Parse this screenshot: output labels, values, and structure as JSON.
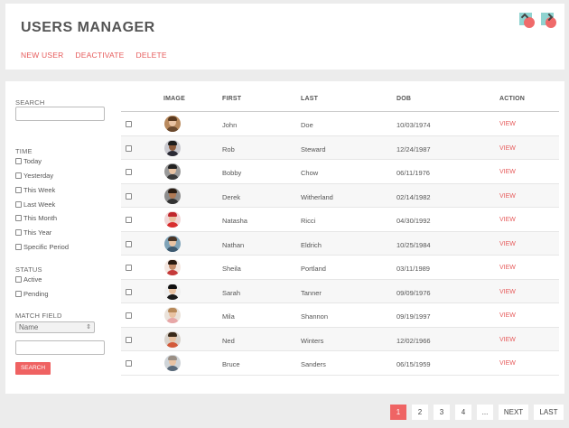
{
  "header": {
    "title": "USERS MANAGER",
    "icons": [
      "import-icon",
      "export-icon"
    ],
    "actions": [
      "NEW USER",
      "DEACTIVATE",
      "DELETE"
    ]
  },
  "sidebar": {
    "search_label": "SEARCH",
    "search_value": "",
    "time_label": "TIME",
    "time_options": [
      "Today",
      "Yesterday",
      "This Week",
      "Last Week",
      "This Month",
      "This Year",
      "Specific Period"
    ],
    "status_label": "STATUS",
    "status_options": [
      "Active",
      "Pending"
    ],
    "match_label": "MATCH FIELD",
    "match_select": "Name",
    "match_value": "",
    "search_button": "SEARCH"
  },
  "table": {
    "columns": [
      "IMAGE",
      "FIRST",
      "LAST",
      "DOB",
      "ACTION"
    ],
    "rows": [
      {
        "first": "John",
        "last": "Doe",
        "dob": "10/03/1974",
        "action": "VIEW",
        "avatar": "avatar-man-brown"
      },
      {
        "first": "Rob",
        "last": "Steward",
        "dob": "12/24/1987",
        "action": "VIEW",
        "avatar": "avatar-man-dark"
      },
      {
        "first": "Bobby",
        "last": "Chow",
        "dob": "06/11/1976",
        "action": "VIEW",
        "avatar": "avatar-man-gray"
      },
      {
        "first": "Derek",
        "last": "Witherland",
        "dob": "02/14/1982",
        "action": "VIEW",
        "avatar": "avatar-man-beard"
      },
      {
        "first": "Natasha",
        "last": "Ricci",
        "dob": "04/30/1992",
        "action": "VIEW",
        "avatar": "avatar-woman-red"
      },
      {
        "first": "Nathan",
        "last": "Eldrich",
        "dob": "10/25/1984",
        "action": "VIEW",
        "avatar": "avatar-man-blue"
      },
      {
        "first": "Sheila",
        "last": "Portland",
        "dob": "03/11/1989",
        "action": "VIEW",
        "avatar": "avatar-woman-dark"
      },
      {
        "first": "Sarah",
        "last": "Tanner",
        "dob": "09/09/1976",
        "action": "VIEW",
        "avatar": "avatar-woman-black"
      },
      {
        "first": "Mila",
        "last": "Shannon",
        "dob": "09/19/1997",
        "action": "VIEW",
        "avatar": "avatar-woman-light"
      },
      {
        "first": "Ned",
        "last": "Winters",
        "dob": "12/02/1966",
        "action": "VIEW",
        "avatar": "avatar-man-light"
      },
      {
        "first": "Bruce",
        "last": "Sanders",
        "dob": "06/15/1959",
        "action": "VIEW",
        "avatar": "avatar-man-bald"
      }
    ]
  },
  "pagination": {
    "pages": [
      "1",
      "2",
      "3",
      "4",
      "..."
    ],
    "active": "1",
    "next": "NEXT",
    "last": "LAST"
  },
  "colors": {
    "accent": "#ef6464",
    "link": "#e65b5b",
    "background": "#ececec",
    "panel": "#ffffff"
  }
}
